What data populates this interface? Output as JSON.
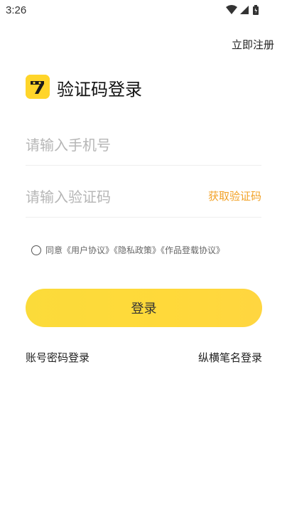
{
  "status_bar": {
    "time": "3:26",
    "icons": [
      "wifi-icon",
      "cellular-signal-icon",
      "battery-icon"
    ]
  },
  "header": {
    "register_link": "立即注册"
  },
  "main": {
    "logo_icon": "app-logo-icon",
    "title": "验证码登录",
    "phone_field": {
      "placeholder": "请输入手机号"
    },
    "code_field": {
      "placeholder": "请输入验证码",
      "get_code_label": "获取验证码"
    },
    "agreement": {
      "prefix": "同意",
      "links": [
        "《用户协议》",
        "《隐私政策》",
        "《作品登载协议》"
      ]
    },
    "login_button": "登录",
    "alt_login": {
      "left": "账号密码登录",
      "right": "纵横笔名登录"
    }
  },
  "colors": {
    "accent": "#FFD93A",
    "link_orange": "#F2A227",
    "placeholder": "#B6B6B6"
  }
}
